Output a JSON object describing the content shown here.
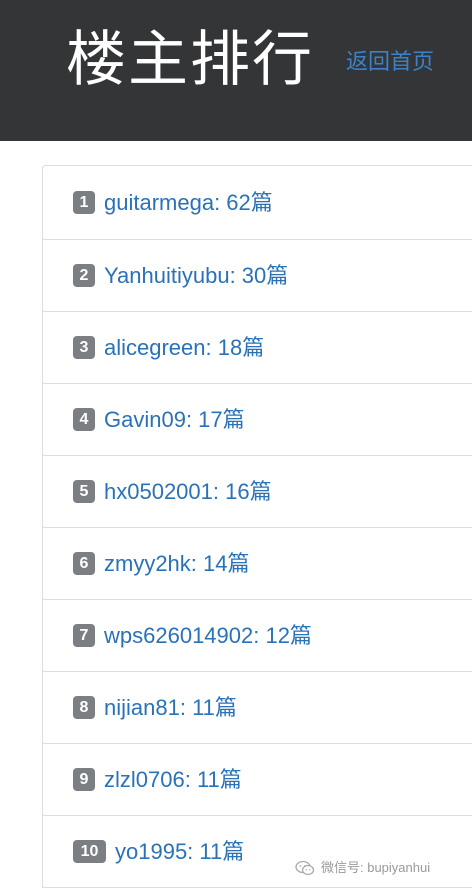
{
  "header": {
    "title": "楼主排行",
    "back_link": "返回首页"
  },
  "ranking": [
    {
      "rank": "1",
      "name": "guitarmega",
      "text": "guitarmega: 62篇"
    },
    {
      "rank": "2",
      "name": "Yanhuitiyubu",
      "text": "Yanhuitiyubu: 30篇"
    },
    {
      "rank": "3",
      "name": "alicegreen",
      "text": "alicegreen: 18篇"
    },
    {
      "rank": "4",
      "name": "Gavin09",
      "text": "Gavin09: 17篇"
    },
    {
      "rank": "5",
      "name": "hx0502001",
      "text": "hx0502001: 16篇"
    },
    {
      "rank": "6",
      "name": "zmyy2hk",
      "text": "zmyy2hk: 14篇"
    },
    {
      "rank": "7",
      "name": "wps626014902",
      "text": "wps626014902: 12篇"
    },
    {
      "rank": "8",
      "name": "nijian81",
      "text": "nijian81: 11篇"
    },
    {
      "rank": "9",
      "name": "zlzl0706",
      "text": "zlzl0706: 11篇"
    },
    {
      "rank": "10",
      "name": "yo1995",
      "text": "yo1995: 11篇"
    }
  ],
  "watermark": {
    "icon": "wechat-icon",
    "text": "微信号: bupiyanhui"
  },
  "colors": {
    "header_bg": "#333536",
    "link": "#2a72b8",
    "badge": "#7b7e82"
  }
}
